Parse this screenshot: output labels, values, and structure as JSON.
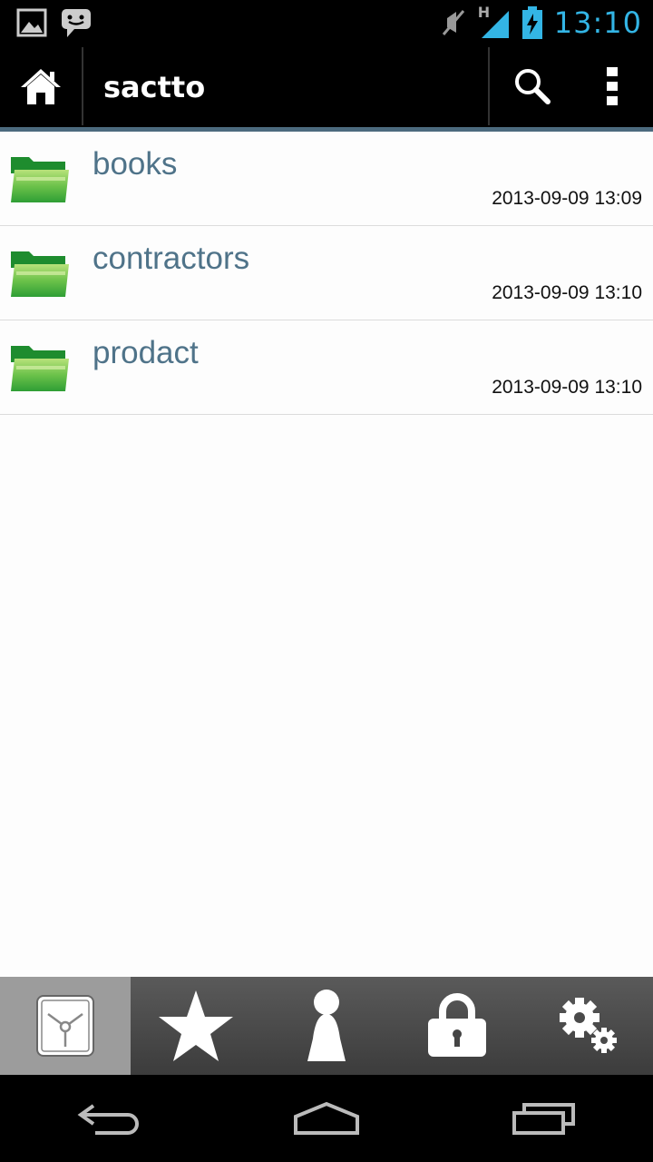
{
  "status_bar": {
    "time": "13:10",
    "network_label": "H",
    "icons": [
      "picture-icon",
      "chat-icon",
      "mute-icon",
      "signal-icon",
      "battery-charging-icon"
    ]
  },
  "action_bar": {
    "title": "sactto",
    "icons": [
      "home-icon",
      "search-icon",
      "overflow-menu-icon"
    ]
  },
  "files": [
    {
      "name": "books",
      "date": "2013-09-09 13:09",
      "icon": "folder-icon"
    },
    {
      "name": "contractors",
      "date": "2013-09-09 13:10",
      "icon": "folder-icon"
    },
    {
      "name": "prodact",
      "date": "2013-09-09 13:10",
      "icon": "folder-icon"
    }
  ],
  "tabs": [
    {
      "icon": "storage-icon",
      "active": true
    },
    {
      "icon": "star-icon",
      "active": false
    },
    {
      "icon": "person-icon",
      "active": false
    },
    {
      "icon": "lock-icon",
      "active": false
    },
    {
      "icon": "settings-icon",
      "active": false
    }
  ],
  "nav": [
    "back-icon",
    "home-nav-icon",
    "recent-apps-icon"
  ],
  "colors": {
    "accent_blue": "#33b5e5",
    "file_name": "#4f7389",
    "folder_green": "#3fb53f",
    "divider": "#4c6a7e"
  }
}
